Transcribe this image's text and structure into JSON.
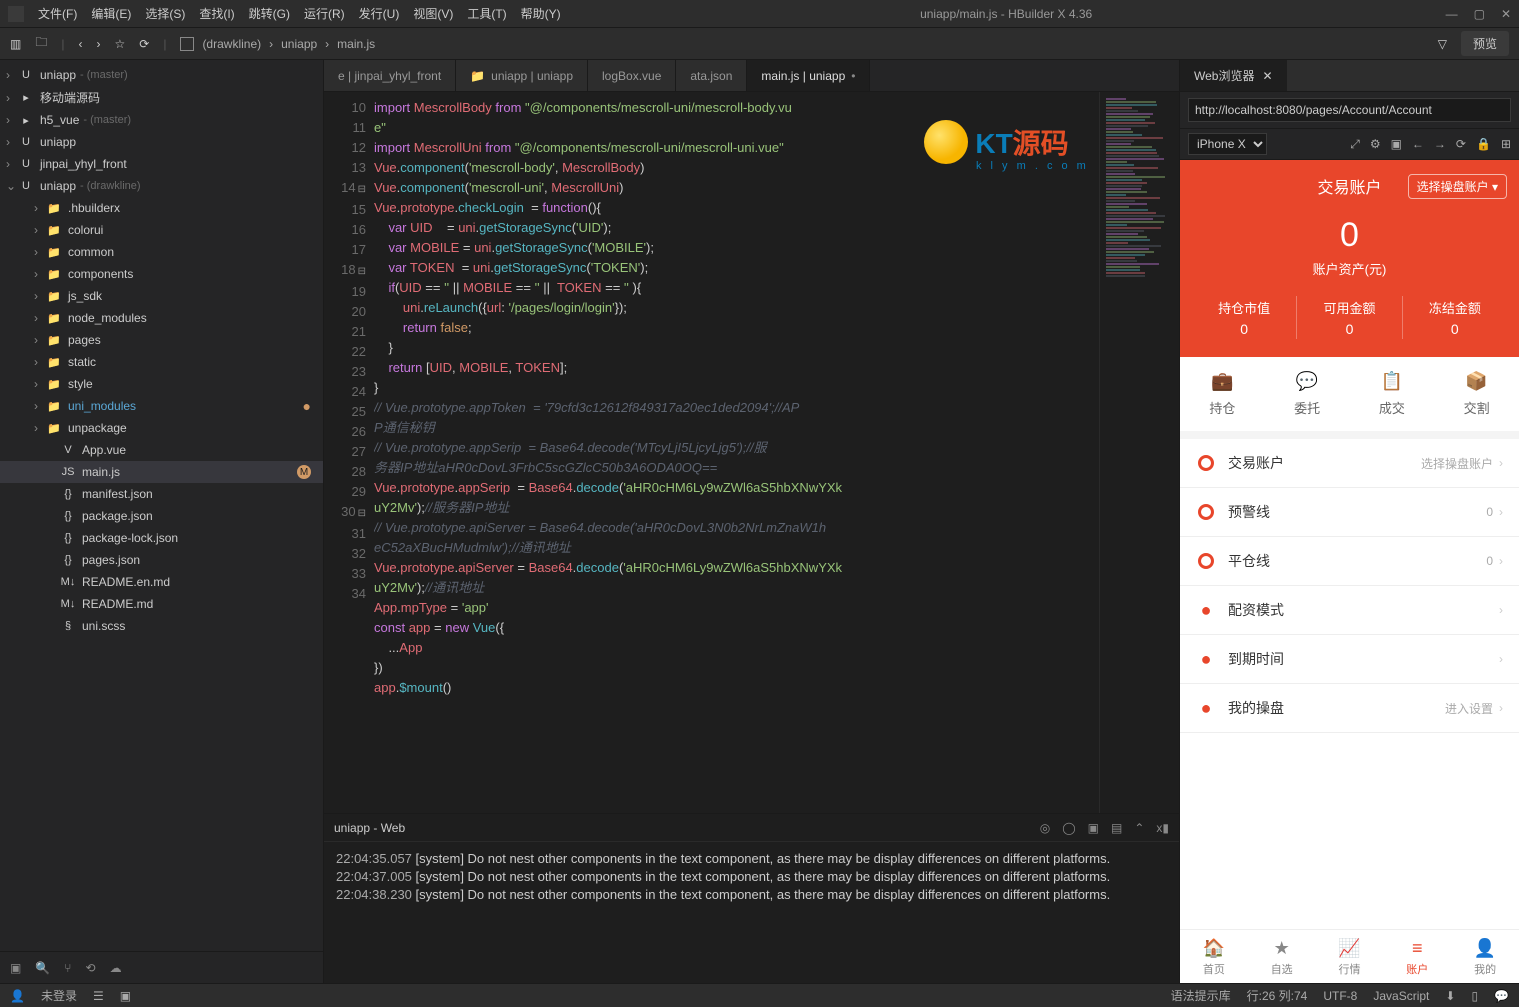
{
  "titlebar": {
    "menus": [
      "文件(F)",
      "编辑(E)",
      "选择(S)",
      "查找(I)",
      "跳转(G)",
      "运行(R)",
      "发行(U)",
      "视图(V)",
      "工具(T)",
      "帮助(Y)"
    ],
    "title": "uniapp/main.js - HBuilder X 4.36"
  },
  "toolbar": {
    "breadcrumb": [
      "(drawkline)",
      "uniapp",
      "main.js"
    ],
    "preview": "预览"
  },
  "explorer": {
    "roots": [
      {
        "icon": "U",
        "label": "uniapp",
        "suffix": "- (master)",
        "chev": "›"
      },
      {
        "icon": "▸",
        "label": "移动端源码",
        "chev": "›",
        "folder": true
      },
      {
        "icon": "▸",
        "label": "h5_vue",
        "suffix": "- (master)",
        "chev": "›"
      },
      {
        "icon": "U",
        "label": "uniapp",
        "chev": "›"
      },
      {
        "icon": "U",
        "label": "jinpai_yhyl_front",
        "chev": "›"
      },
      {
        "icon": "U",
        "label": "uniapp",
        "suffix": "- (drawkline)",
        "chev": "⌄",
        "open": true
      }
    ],
    "children": [
      {
        "indent": 2,
        "icon": "📁",
        "label": ".hbuilderx",
        "chev": "›"
      },
      {
        "indent": 2,
        "icon": "📁",
        "label": "colorui",
        "chev": "›"
      },
      {
        "indent": 2,
        "icon": "📁",
        "label": "common",
        "chev": "›"
      },
      {
        "indent": 2,
        "icon": "📁",
        "label": "components",
        "chev": "›"
      },
      {
        "indent": 2,
        "icon": "📁",
        "label": "js_sdk",
        "chev": "›"
      },
      {
        "indent": 2,
        "icon": "📁",
        "label": "node_modules",
        "chev": "›"
      },
      {
        "indent": 2,
        "icon": "📁",
        "label": "pages",
        "chev": "›"
      },
      {
        "indent": 2,
        "icon": "📁",
        "label": "static",
        "chev": "›"
      },
      {
        "indent": 2,
        "icon": "📁",
        "label": "style",
        "chev": "›"
      },
      {
        "indent": 2,
        "icon": "📁",
        "label": "uni_modules",
        "chev": "›",
        "link": true,
        "dot": true
      },
      {
        "indent": 2,
        "icon": "📁",
        "label": "unpackage",
        "chev": "›"
      },
      {
        "indent": 3,
        "icon": "V",
        "label": "App.vue"
      },
      {
        "indent": 3,
        "icon": "JS",
        "label": "main.js",
        "active": true,
        "badge": "M"
      },
      {
        "indent": 3,
        "icon": "{}",
        "label": "manifest.json"
      },
      {
        "indent": 3,
        "icon": "{}",
        "label": "package.json"
      },
      {
        "indent": 3,
        "icon": "{}",
        "label": "package-lock.json"
      },
      {
        "indent": 3,
        "icon": "{}",
        "label": "pages.json"
      },
      {
        "indent": 3,
        "icon": "M↓",
        "label": "README.en.md"
      },
      {
        "indent": 3,
        "icon": "M↓",
        "label": "README.md"
      },
      {
        "indent": 3,
        "icon": "§",
        "label": "uni.scss"
      }
    ]
  },
  "tabs": [
    {
      "label": "e | jinpai_yhyl_front"
    },
    {
      "label": "uniapp | uniapp",
      "icon": "📁"
    },
    {
      "label": "logBox.vue"
    },
    {
      "label": "ata.json"
    },
    {
      "label": "main.js | uniapp",
      "active": true
    }
  ],
  "code": {
    "start": 10,
    "lines": [
      {
        "html": "<span class='kw'>import</span> <span class='id'>MescrollBody</span> <span class='kw'>from</span> <span class='str'>\"@/components/mescroll-uni/mescroll-body.vu</span>"
      },
      {
        "html": "<span class='str'>e\"</span>",
        "noNum": true
      },
      {
        "n": 11,
        "html": "<span class='kw'>import</span> <span class='id'>MescrollUni</span> <span class='kw'>from</span> <span class='str'>\"@/components/mescroll-uni/mescroll-uni.vue\"</span>"
      },
      {
        "n": 12,
        "html": "<span class='id'>Vue</span>.<span class='fn'>component</span>(<span class='str'>'mescroll-body'</span>, <span class='id'>MescrollBody</span>)"
      },
      {
        "n": 13,
        "html": "<span class='id'>Vue</span>.<span class='fn'>component</span>(<span class='str'>'mescroll-uni'</span>, <span class='id'>MescrollUni</span>)"
      },
      {
        "n": 14,
        "fold": true,
        "html": "<span class='id'>Vue</span>.<span class='id'>prototype</span>.<span class='fn'>checkLogin</span>  = <span class='kw'>function</span>(){"
      },
      {
        "n": 15,
        "html": "    <span class='kw'>var</span> <span class='id'>UID</span>    = <span class='id'>uni</span>.<span class='fn'>getStorageSync</span>(<span class='str'>'UID'</span>);"
      },
      {
        "n": 16,
        "html": "    <span class='kw'>var</span> <span class='id'>MOBILE</span> = <span class='id'>uni</span>.<span class='fn'>getStorageSync</span>(<span class='str'>'MOBILE'</span>);"
      },
      {
        "n": 17,
        "html": "    <span class='kw'>var</span> <span class='id'>TOKEN</span>  = <span class='id'>uni</span>.<span class='fn'>getStorageSync</span>(<span class='str'>'TOKEN'</span>);"
      },
      {
        "n": 18,
        "fold": true,
        "html": "    <span class='kw'>if</span>(<span class='id'>UID</span> == <span class='str'>''</span> || <span class='id'>MOBILE</span> == <span class='str'>''</span> ||  <span class='id'>TOKEN</span> == <span class='str'>''</span> ){"
      },
      {
        "n": 19,
        "html": "        <span class='id'>uni</span>.<span class='fn'>reLaunch</span>({<span class='id'>url</span>: <span class='str'>'/pages/login/login'</span>});"
      },
      {
        "n": 20,
        "html": "        <span class='kw'>return</span> <span class='bool'>false</span>;"
      },
      {
        "n": 21,
        "html": "    }"
      },
      {
        "n": 22,
        "html": "    <span class='kw'>return</span> [<span class='id'>UID</span>, <span class='id'>MOBILE</span>, <span class='id'>TOKEN</span>];"
      },
      {
        "n": 23,
        "html": "}"
      },
      {
        "n": 24,
        "html": "<span class='cm'>// Vue.prototype.appToken  = '79cfd3c12612f849317a20ec1ded2094';//AP</span>"
      },
      {
        "html": "<span class='cm'>P通信秘钥</span>",
        "noNum": true
      },
      {
        "n": 25,
        "html": "<span class='cm'>// Vue.prototype.appSerip  = Base64.decode('MTcyLjI5LjcyLjg5');//服</span>"
      },
      {
        "html": "<span class='cm'>务器IP地址aHR0cDovL3FrbC5scGZlcC50b3A6ODA0OQ==</span>",
        "noNum": true
      },
      {
        "n": 26,
        "html": "<span class='id'>Vue</span>.<span class='id'>prototype</span>.<span class='id'>appSerip</span>  = <span class='id'>Base64</span>.<span class='fn'>decode</span>(<span class='str'>'aHR0cHM6Ly9wZWl6aS5hbXNwYXk</span>"
      },
      {
        "html": "<span class='str'>uY2Mv'</span>);<span class='cm'>//服务器IP地址</span>",
        "noNum": true
      },
      {
        "n": 27,
        "html": "<span class='cm'>// Vue.prototype.apiServer = Base64.decode('aHR0cDovL3N0b2NrLmZnaW1h</span>"
      },
      {
        "html": "<span class='cm'>eC52aXBucHMudmlw');//通讯地址</span>",
        "noNum": true
      },
      {
        "n": 28,
        "html": "<span class='id'>Vue</span>.<span class='id'>prototype</span>.<span class='id'>apiServer</span> = <span class='id'>Base64</span>.<span class='fn'>decode</span>(<span class='str'>'aHR0cHM6Ly9wZWl6aS5hbXNwYXk</span>"
      },
      {
        "html": "<span class='str'>uY2Mv'</span>);<span class='cm'>//通讯地址</span>",
        "noNum": true
      },
      {
        "n": 29,
        "html": "<span class='id'>App</span>.<span class='id'>mpType</span> = <span class='str'>'app'</span>"
      },
      {
        "n": 30,
        "fold": true,
        "html": "<span class='kw'>const</span> <span class='id'>app</span> = <span class='kw'>new</span> <span class='fn'>Vue</span>({"
      },
      {
        "n": 31,
        "html": "    ...<span class='id'>App</span>"
      },
      {
        "n": 32,
        "html": "})"
      },
      {
        "n": 33,
        "html": "<span class='id'>app</span>.<span class='fn'>$mount</span>()"
      },
      {
        "n": 34,
        "html": ""
      }
    ]
  },
  "console": {
    "title": "uniapp - Web",
    "lines": [
      {
        "ts": "22:04:35.057",
        "msg": "[system] Do not nest other components in the text component, as there may be display differences on different platforms."
      },
      {
        "ts": "22:04:37.005",
        "msg": "[system] Do not nest other components in the text component, as there may be display differences on different platforms."
      },
      {
        "ts": "22:04:38.230",
        "msg": "[system] Do not nest other components in the text component, as there may be display differences on different platforms."
      }
    ]
  },
  "browser": {
    "tab": "Web浏览器",
    "url": "http://localhost:8080/pages/Account/Account",
    "device": "iPhone X"
  },
  "phone": {
    "header": {
      "title": "交易账户",
      "selector": "选择操盘账户 ▾",
      "big": "0",
      "bigLabel": "账户资产(元)"
    },
    "stats": [
      {
        "label": "持仓市值",
        "value": "0"
      },
      {
        "label": "可用金额",
        "value": "0"
      },
      {
        "label": "冻结金额",
        "value": "0"
      }
    ],
    "quick": [
      {
        "icon": "💼",
        "label": "持仓"
      },
      {
        "icon": "💬",
        "label": "委托"
      },
      {
        "icon": "📋",
        "label": "成交"
      },
      {
        "icon": "📦",
        "label": "交割"
      }
    ],
    "list": [
      {
        "color": "#e8462b",
        "ring": true,
        "label": "交易账户",
        "right": "选择操盘账户"
      },
      {
        "color": "#e8462b",
        "ring": true,
        "label": "预警线",
        "right": "0"
      },
      {
        "color": "#e8462b",
        "ring": true,
        "label": "平仓线",
        "right": "0"
      },
      {
        "color": "#e8462b",
        "label": "配资模式"
      },
      {
        "color": "#e8462b",
        "label": "到期时间"
      },
      {
        "color": "#e8462b",
        "label": "我的操盘",
        "right": "进入设置"
      }
    ],
    "nav": [
      {
        "icon": "🏠",
        "label": "首页"
      },
      {
        "icon": "★",
        "label": "自选"
      },
      {
        "icon": "📈",
        "label": "行情"
      },
      {
        "icon": "≡",
        "label": "账户",
        "active": true
      },
      {
        "icon": "👤",
        "label": "我的"
      }
    ]
  },
  "statusbar": {
    "login": "未登录",
    "hints": "语法提示库",
    "pos": "行:26  列:74",
    "enc": "UTF-8",
    "lang": "JavaScript"
  },
  "watermark": {
    "text": "KT源码",
    "sub": "k l y m . c o m"
  }
}
